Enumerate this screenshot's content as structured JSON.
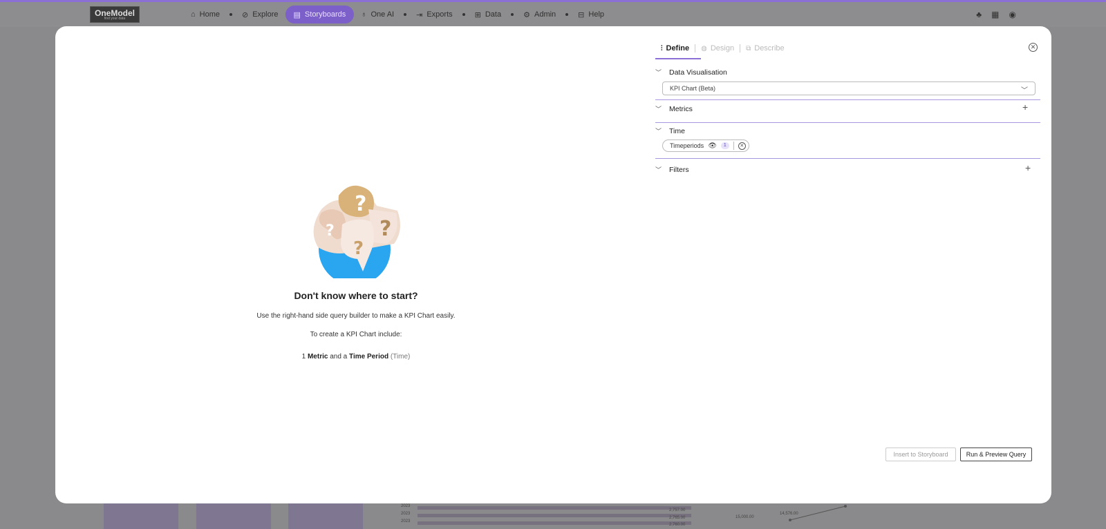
{
  "nav": {
    "logo": "OneModel",
    "logo_tagline": "find your data",
    "items": [
      {
        "label": "Home",
        "icon": "home-icon",
        "glyph": "⌂"
      },
      {
        "label": "Explore",
        "icon": "compass-icon",
        "glyph": "⊘"
      },
      {
        "label": "Storyboards",
        "icon": "storyboard-icon",
        "glyph": "▤"
      },
      {
        "label": "One AI",
        "icon": "bulb-icon",
        "glyph": "♁"
      },
      {
        "label": "Exports",
        "icon": "export-icon",
        "glyph": "⇥"
      },
      {
        "label": "Data",
        "icon": "data-icon",
        "glyph": "⊞"
      },
      {
        "label": "Admin",
        "icon": "gear-icon",
        "glyph": "⚙"
      },
      {
        "label": "Help",
        "icon": "book-icon",
        "glyph": "⊟"
      }
    ],
    "active": "Storyboards",
    "accent": "#7c5fc9"
  },
  "background": {
    "rows": [
      {
        "label": "2023",
        "value": "2,757.00"
      },
      {
        "label": "2023",
        "value": "2,765.00"
      },
      {
        "label": "2023",
        "value": "2,760.00"
      }
    ],
    "axis_value": "15,000.00",
    "point_label": "14,576.00"
  },
  "modal": {
    "empty": {
      "title": "Don't know where to start?",
      "line1": "Use the right-hand side query builder to make a KPI Chart easily.",
      "line2": "To create a KPI Chart include:",
      "line3_prefix": "1 ",
      "line3_metric": "Metric",
      "line3_mid": " and a ",
      "line3_time": "Time Period",
      "line3_suffix": " (Time)"
    },
    "tabs": [
      {
        "label": "Define",
        "icon": "sliders-icon"
      },
      {
        "label": "Design",
        "icon": "palette-icon"
      },
      {
        "label": "Describe",
        "icon": "describe-icon"
      }
    ],
    "sections": {
      "data_visualisation": "Data Visualisation",
      "visualisation_value": "KPI Chart (Beta)",
      "metrics": "Metrics",
      "time": "Time",
      "timeperiod_chip": "Timeperiods",
      "timeperiod_count": "1",
      "filters": "Filters"
    },
    "buttons": {
      "insert": "Insert to Storyboard",
      "run": "Run & Preview Query"
    }
  }
}
